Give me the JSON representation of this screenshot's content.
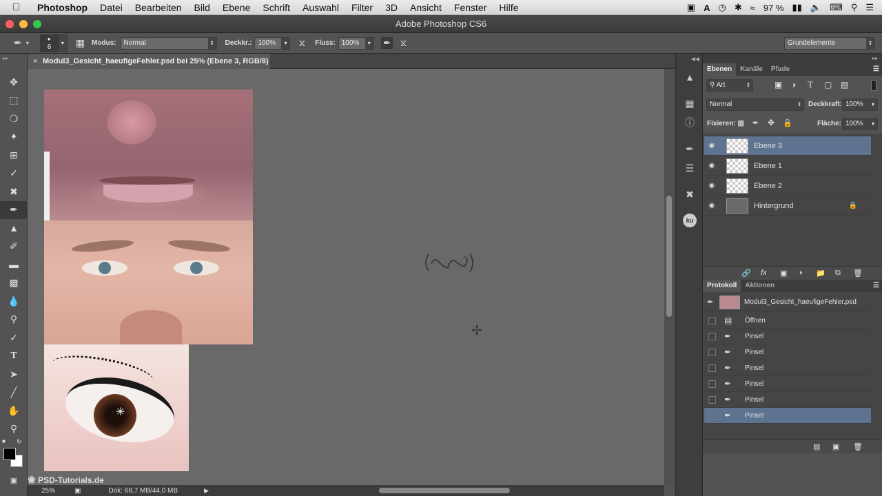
{
  "menu": {
    "items": [
      "Photoshop",
      "Datei",
      "Bearbeiten",
      "Bild",
      "Ebene",
      "Schrift",
      "Auswahl",
      "Filter",
      "3D",
      "Ansicht",
      "Fenster",
      "Hilfe"
    ],
    "battery": "97 %"
  },
  "window": {
    "title": "Adobe Photoshop CS6"
  },
  "options": {
    "brush_size": "6",
    "mode_label": "Modus:",
    "mode_value": "Normal",
    "opacity_label": "Deckkr.:",
    "opacity_value": "100%",
    "flow_label": "Fluss:",
    "flow_value": "100%",
    "workspace": "Grundelemente"
  },
  "document": {
    "tab_title": "Modul3_Gesicht_haeufigeFehler.psd bei 25% (Ebene 3, RGB/8) *",
    "zoom": "25%",
    "doc_size": "Dok: 68,7 MB/44,0 MB",
    "watermark": "PSD-Tutorials.de"
  },
  "layers_panel": {
    "tabs": [
      "Ebenen",
      "Kanäle",
      "Pfade"
    ],
    "filter": "Art",
    "blend": "Normal",
    "opacity_label": "Deckkraft:",
    "opacity_value": "100%",
    "lock_label": "Fixieren:",
    "fill_label": "Fläche:",
    "fill_value": "100%",
    "layers": [
      "Ebene 3",
      "Ebene 1",
      "Ebene 2",
      "Hintergrund"
    ]
  },
  "history_panel": {
    "tabs": [
      "Protokoll",
      "Aktionen"
    ],
    "snapshot": "Modul3_Gesicht_haeufigeFehler.psd",
    "items": [
      "Öffnen",
      "Pinsel",
      "Pinsel",
      "Pinsel",
      "Pinsel",
      "Pinsel",
      "Pinsel"
    ]
  },
  "colors": {
    "accent_selection": "#5e7390",
    "panel_bg": "#535353",
    "canvas_bg": "#696969"
  }
}
